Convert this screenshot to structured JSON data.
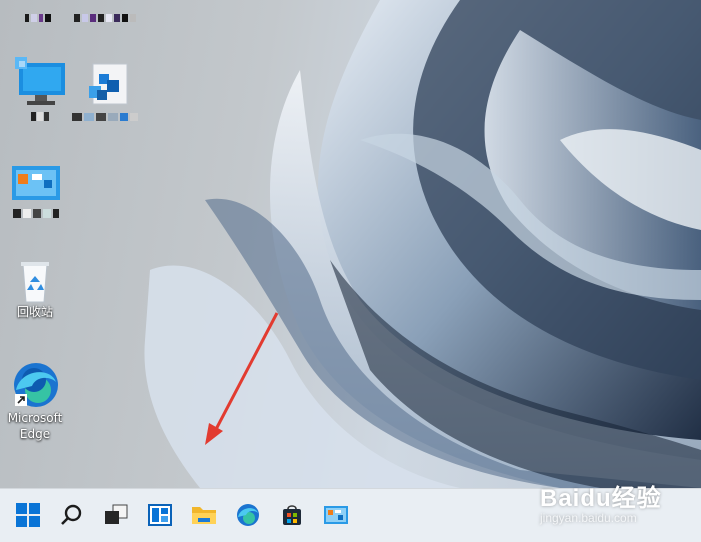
{
  "desktop": {
    "icons": [
      {
        "label": "回收站"
      },
      {
        "label": "Microsoft Edge"
      }
    ]
  },
  "taskbar": {
    "items": [
      "start-icon",
      "search-icon",
      "task-view-icon",
      "widgets-icon",
      "file-explorer-icon",
      "edge-icon",
      "store-icon",
      "control-panel-icon"
    ]
  },
  "watermark": {
    "brand": "Baidu经验",
    "url": "jingyan.baidu.com"
  },
  "colors": {
    "accent": "#0a74d6",
    "taskbar": "#e9eef3",
    "arrow": "#e23b30"
  }
}
